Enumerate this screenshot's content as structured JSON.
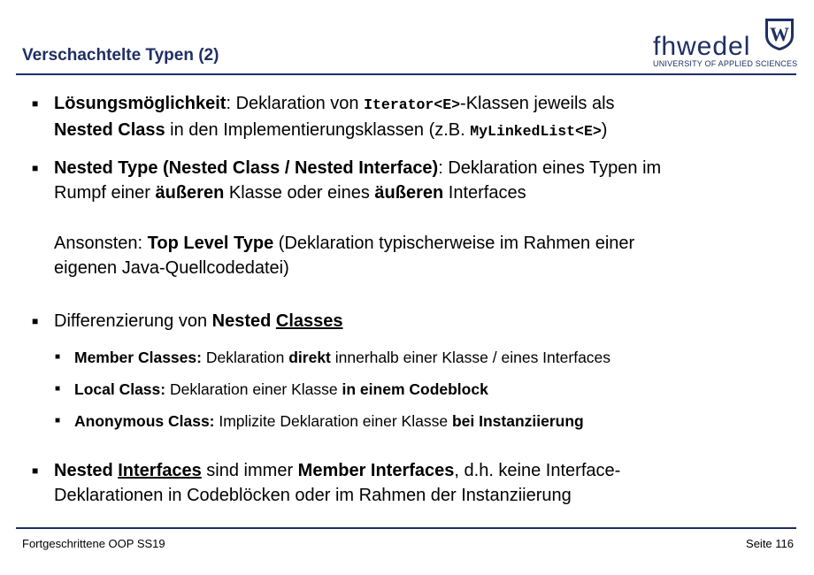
{
  "header": {
    "title": "Verschachtelte Typen (2)",
    "logo": {
      "word": "fhwedel",
      "subtitle": "UNIVERSITY OF APPLIED SCIENCES",
      "seal_letter": "W"
    }
  },
  "bullets": {
    "b1": {
      "p1": "Lösungsmöglichkeit",
      "p2": ": Deklaration von ",
      "p3": "Iterator<E>",
      "p4": "-Klassen jeweils als",
      "p5": "Nested Class",
      "p6": " in den Implementierungsklassen (z.B. ",
      "p7": "MyLinkedList<E>",
      "p8": ")"
    },
    "b2": {
      "p1": "Nested Type (Nested Class / Nested Interface)",
      "p2": ": Deklaration eines Typen im",
      "p3": "Rumpf einer ",
      "p4": "äußeren",
      "p5": " Klasse oder eines ",
      "p6": "äußeren",
      "p7": " Interfaces"
    },
    "b2_extra": {
      "p1": "Ansonsten: ",
      "p2": "Top Level Type",
      "p3": " (Deklaration typischerweise im Rahmen einer",
      "p4": "eigenen Java-Quellcodedatei)"
    },
    "b3": {
      "p1": "Differenzierung von ",
      "p2": "Nested ",
      "p3": "Classes"
    },
    "sub1": {
      "p1": "Member Classes:",
      "p2": " Deklaration ",
      "p3": "direkt",
      "p4": " innerhalb einer Klasse / eines Interfaces"
    },
    "sub2": {
      "p1": "Local Class:",
      "p2": " Deklaration einer Klasse ",
      "p3": "in einem Codeblock"
    },
    "sub3": {
      "p1": "Anonymous Class:",
      "p2": " Implizite Deklaration einer Klasse ",
      "p3": "bei Instanziierung"
    },
    "b4": {
      "p1": "Nested ",
      "p2": "Interfaces",
      "p3": " sind immer ",
      "p4": "Member Interfaces",
      "p5": ", d.h. keine Interface-",
      "p6": "Deklarationen in Codeblöcken oder im Rahmen der Instanziierung"
    }
  },
  "footer": {
    "left": "Fortgeschrittene OOP SS19",
    "right": "Seite 116"
  },
  "colors": {
    "accent": "#1f2f63"
  }
}
